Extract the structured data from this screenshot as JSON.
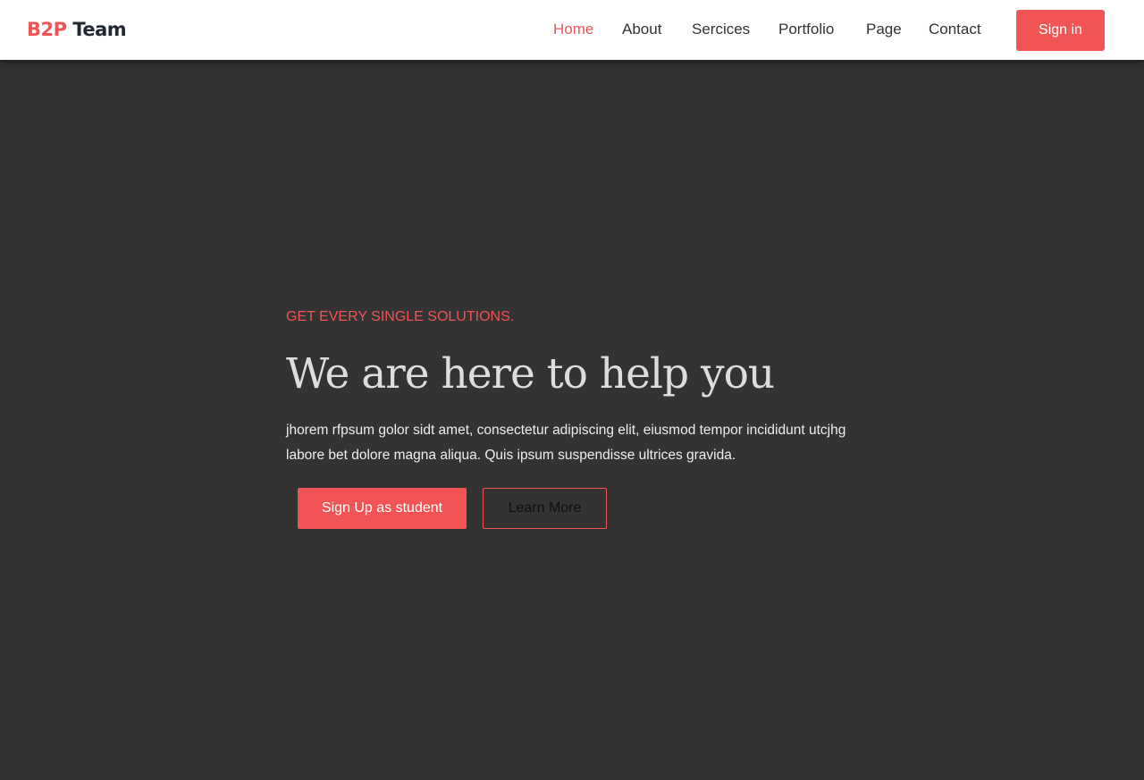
{
  "brand": {
    "part1": "B2P",
    "part2": " Team",
    "accent_color": "#f05454"
  },
  "nav": {
    "items": [
      {
        "label": "Home",
        "active": true
      },
      {
        "label": "About",
        "active": false
      },
      {
        "label": "Sercices",
        "active": false
      },
      {
        "label": "Portfolio",
        "active": false
      },
      {
        "label": "Page",
        "active": false
      },
      {
        "label": "Contact",
        "active": false
      }
    ],
    "signin_label": "Sign in"
  },
  "hero": {
    "eyebrow": "GET EVERY SINGLE SOLUTIONS.",
    "headline": "We are here to help you",
    "description": "jhorem rfpsum golor sidt amet, consectetur adipiscing elit, eiusmod tempor incididunt utcjhg labore bet dolore magna aliqua. Quis ipsum suspendisse ultrices gravida.",
    "primary_button": "Sign Up as student",
    "secondary_button": "Learn More"
  },
  "colors": {
    "background": "#333333",
    "accent": "#f05454",
    "nav_bg": "#ffffff"
  }
}
